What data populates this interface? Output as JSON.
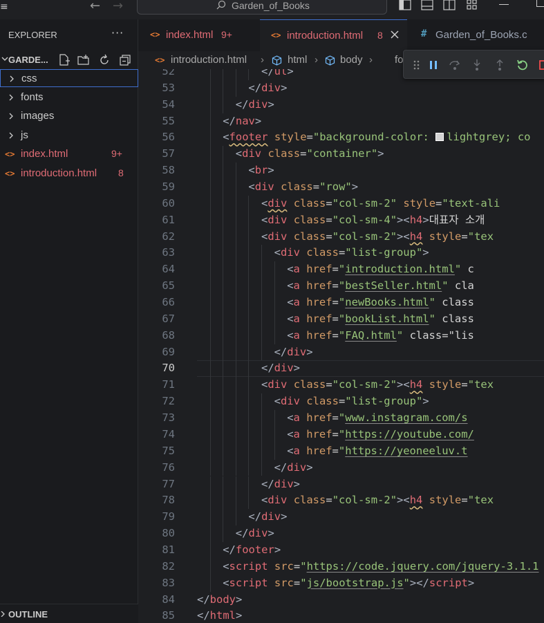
{
  "titlebar": {
    "search_text": "Garden_of_Books",
    "back_arrow": "←",
    "forward_arrow": "→"
  },
  "sidebar": {
    "header": "EXPLORER",
    "more": "···",
    "folder": "GARDE...",
    "items": [
      {
        "label": "css",
        "type": "folder"
      },
      {
        "label": "fonts",
        "type": "folder"
      },
      {
        "label": "images",
        "type": "folder"
      },
      {
        "label": "js",
        "type": "folder"
      },
      {
        "label": "index.html",
        "type": "file",
        "count": "9+"
      },
      {
        "label": "introduction.html",
        "type": "file",
        "count": "8"
      }
    ],
    "outline": "OUTLINE"
  },
  "tabs": [
    {
      "icon": "<>",
      "label": "index.html",
      "badge": "9+"
    },
    {
      "icon": "<>",
      "label": "introduction.html",
      "badge": "8"
    },
    {
      "icon": "#",
      "label": "Garden_of_Books.c"
    }
  ],
  "breadcrumb": [
    "introduction.html",
    "html",
    "body",
    "fo"
  ],
  "colors": {
    "accent": "#3f6fcf",
    "error": "#e06c75",
    "debug_continue": "#3794ff",
    "debug_restart": "#89d185",
    "debug_stop": "#f14c4c"
  },
  "editor": {
    "current_line": "70",
    "lines": [
      {
        "n": "52",
        "indent": 10,
        "tokens": [
          [
            "br",
            "</"
          ],
          [
            "tag",
            "ul"
          ],
          [
            "br",
            ">"
          ]
        ]
      },
      {
        "n": "53",
        "indent": 8,
        "tokens": [
          [
            "br",
            "</"
          ],
          [
            "tag",
            "div"
          ],
          [
            "br",
            ">"
          ]
        ]
      },
      {
        "n": "54",
        "indent": 6,
        "tokens": [
          [
            "br",
            "</"
          ],
          [
            "tag",
            "div"
          ],
          [
            "br",
            ">"
          ]
        ]
      },
      {
        "n": "55",
        "indent": 4,
        "tokens": [
          [
            "br",
            "</"
          ],
          [
            "tag",
            "nav"
          ],
          [
            "br",
            ">"
          ]
        ]
      },
      {
        "n": "56",
        "indent": 4,
        "tokens": [
          [
            "br",
            "<"
          ],
          [
            "tagsq",
            "footer"
          ],
          [
            "txt",
            " "
          ],
          [
            "attr",
            "style"
          ],
          [
            "txt",
            "="
          ],
          [
            "str",
            "\"background-color: "
          ],
          [
            "swatch",
            ""
          ],
          [
            "str",
            "lightgrey; co"
          ]
        ]
      },
      {
        "n": "57",
        "indent": 6,
        "tokens": [
          [
            "br",
            "<"
          ],
          [
            "tag",
            "div"
          ],
          [
            "txt",
            " "
          ],
          [
            "attr",
            "class"
          ],
          [
            "txt",
            "="
          ],
          [
            "str",
            "\"container\""
          ],
          [
            "br",
            ">"
          ]
        ]
      },
      {
        "n": "58",
        "indent": 8,
        "tokens": [
          [
            "br",
            "<"
          ],
          [
            "tag",
            "br"
          ],
          [
            "br",
            ">"
          ]
        ]
      },
      {
        "n": "59",
        "indent": 8,
        "tokens": [
          [
            "br",
            "<"
          ],
          [
            "tag",
            "div"
          ],
          [
            "txt",
            " "
          ],
          [
            "attr",
            "class"
          ],
          [
            "txt",
            "="
          ],
          [
            "str",
            "\"row\""
          ],
          [
            "br",
            ">"
          ]
        ]
      },
      {
        "n": "60",
        "indent": 10,
        "tokens": [
          [
            "br",
            "<"
          ],
          [
            "tagsq",
            "div"
          ],
          [
            "txt",
            " "
          ],
          [
            "attr",
            "class"
          ],
          [
            "txt",
            "="
          ],
          [
            "str",
            "\"col-sm-2\""
          ],
          [
            "txt",
            " "
          ],
          [
            "attr",
            "style"
          ],
          [
            "txt",
            "="
          ],
          [
            "str",
            "\"text-ali"
          ]
        ]
      },
      {
        "n": "61",
        "indent": 10,
        "tokens": [
          [
            "br",
            "<"
          ],
          [
            "tag",
            "div"
          ],
          [
            "txt",
            " "
          ],
          [
            "attr",
            "class"
          ],
          [
            "txt",
            "="
          ],
          [
            "str",
            "\"col-sm-4\""
          ],
          [
            "br",
            ">"
          ],
          [
            "br",
            "<"
          ],
          [
            "tag",
            "h4"
          ],
          [
            "br",
            ">"
          ],
          [
            "txt",
            "대표자 소개"
          ]
        ]
      },
      {
        "n": "62",
        "indent": 10,
        "tokens": [
          [
            "br",
            "<"
          ],
          [
            "tag",
            "div"
          ],
          [
            "txt",
            " "
          ],
          [
            "attr",
            "class"
          ],
          [
            "txt",
            "="
          ],
          [
            "str",
            "\"col-sm-2\""
          ],
          [
            "br",
            ">"
          ],
          [
            "br",
            "<"
          ],
          [
            "tagsq",
            "h4"
          ],
          [
            "txt",
            " "
          ],
          [
            "attr",
            "style"
          ],
          [
            "txt",
            "="
          ],
          [
            "str",
            "\"tex"
          ]
        ]
      },
      {
        "n": "63",
        "indent": 12,
        "tokens": [
          [
            "br",
            "<"
          ],
          [
            "tag",
            "div"
          ],
          [
            "txt",
            " "
          ],
          [
            "attr",
            "class"
          ],
          [
            "txt",
            "="
          ],
          [
            "str",
            "\"list-group\""
          ],
          [
            "br",
            ">"
          ]
        ]
      },
      {
        "n": "64",
        "indent": 14,
        "tokens": [
          [
            "br",
            "<"
          ],
          [
            "tag",
            "a"
          ],
          [
            "txt",
            " "
          ],
          [
            "attr",
            "href"
          ],
          [
            "txt",
            "="
          ],
          [
            "str",
            "\""
          ],
          [
            "strul",
            "introduction.html"
          ],
          [
            "str",
            "\""
          ],
          [
            "txt",
            " c"
          ]
        ]
      },
      {
        "n": "65",
        "indent": 14,
        "tokens": [
          [
            "br",
            "<"
          ],
          [
            "tag",
            "a"
          ],
          [
            "txt",
            " "
          ],
          [
            "attr",
            "href"
          ],
          [
            "txt",
            "="
          ],
          [
            "str",
            "\""
          ],
          [
            "strul",
            "bestSeller.html"
          ],
          [
            "str",
            "\""
          ],
          [
            "txt",
            " cla"
          ]
        ]
      },
      {
        "n": "66",
        "indent": 14,
        "tokens": [
          [
            "br",
            "<"
          ],
          [
            "tag",
            "a"
          ],
          [
            "txt",
            " "
          ],
          [
            "attr",
            "href"
          ],
          [
            "txt",
            "="
          ],
          [
            "str",
            "\""
          ],
          [
            "strul",
            "newBooks.html"
          ],
          [
            "str",
            "\""
          ],
          [
            "txt",
            " class"
          ]
        ]
      },
      {
        "n": "67",
        "indent": 14,
        "tokens": [
          [
            "br",
            "<"
          ],
          [
            "tag",
            "a"
          ],
          [
            "txt",
            " "
          ],
          [
            "attr",
            "href"
          ],
          [
            "txt",
            "="
          ],
          [
            "str",
            "\""
          ],
          [
            "strul",
            "bookList.html"
          ],
          [
            "str",
            "\""
          ],
          [
            "txt",
            " class"
          ]
        ]
      },
      {
        "n": "68",
        "indent": 14,
        "tokens": [
          [
            "br",
            "<"
          ],
          [
            "tag",
            "a"
          ],
          [
            "txt",
            " "
          ],
          [
            "attr",
            "href"
          ],
          [
            "txt",
            "="
          ],
          [
            "str",
            "\""
          ],
          [
            "strul",
            "FAQ.html"
          ],
          [
            "str",
            "\""
          ],
          [
            "txt",
            " class"
          ],
          [
            "txt",
            "=\"lis"
          ]
        ]
      },
      {
        "n": "69",
        "indent": 12,
        "tokens": [
          [
            "br",
            "</"
          ],
          [
            "tag",
            "div"
          ],
          [
            "br",
            ">"
          ]
        ]
      },
      {
        "n": "70",
        "indent": 10,
        "tokens": [
          [
            "br",
            "</"
          ],
          [
            "tag",
            "div"
          ],
          [
            "br",
            ">"
          ]
        ]
      },
      {
        "n": "71",
        "indent": 10,
        "tokens": [
          [
            "br",
            "<"
          ],
          [
            "tag",
            "div"
          ],
          [
            "txt",
            " "
          ],
          [
            "attr",
            "class"
          ],
          [
            "txt",
            "="
          ],
          [
            "str",
            "\"col-sm-2\""
          ],
          [
            "br",
            ">"
          ],
          [
            "br",
            "<"
          ],
          [
            "tagsq",
            "h4"
          ],
          [
            "txt",
            " "
          ],
          [
            "attr",
            "style"
          ],
          [
            "txt",
            "="
          ],
          [
            "str",
            "\"tex"
          ]
        ]
      },
      {
        "n": "72",
        "indent": 12,
        "tokens": [
          [
            "br",
            "<"
          ],
          [
            "tag",
            "div"
          ],
          [
            "txt",
            " "
          ],
          [
            "attr",
            "class"
          ],
          [
            "txt",
            "="
          ],
          [
            "str",
            "\"list-group\""
          ],
          [
            "br",
            ">"
          ]
        ]
      },
      {
        "n": "73",
        "indent": 14,
        "tokens": [
          [
            "br",
            "<"
          ],
          [
            "tag",
            "a"
          ],
          [
            "txt",
            " "
          ],
          [
            "attr",
            "href"
          ],
          [
            "txt",
            "="
          ],
          [
            "str",
            "\""
          ],
          [
            "strul",
            "www.instagram.com/s"
          ]
        ]
      },
      {
        "n": "74",
        "indent": 14,
        "tokens": [
          [
            "br",
            "<"
          ],
          [
            "tag",
            "a"
          ],
          [
            "txt",
            " "
          ],
          [
            "attr",
            "href"
          ],
          [
            "txt",
            "="
          ],
          [
            "str",
            "\""
          ],
          [
            "strul",
            "https://youtube.com/"
          ]
        ]
      },
      {
        "n": "75",
        "indent": 14,
        "tokens": [
          [
            "br",
            "<"
          ],
          [
            "tag",
            "a"
          ],
          [
            "txt",
            " "
          ],
          [
            "attr",
            "href"
          ],
          [
            "txt",
            "="
          ],
          [
            "str",
            "\""
          ],
          [
            "strul",
            "https://yeoneeluv.t"
          ]
        ]
      },
      {
        "n": "76",
        "indent": 12,
        "tokens": [
          [
            "br",
            "</"
          ],
          [
            "tag",
            "div"
          ],
          [
            "br",
            ">"
          ]
        ]
      },
      {
        "n": "77",
        "indent": 10,
        "tokens": [
          [
            "br",
            "</"
          ],
          [
            "tag",
            "div"
          ],
          [
            "br",
            ">"
          ]
        ]
      },
      {
        "n": "78",
        "indent": 10,
        "tokens": [
          [
            "br",
            "<"
          ],
          [
            "tag",
            "div"
          ],
          [
            "txt",
            " "
          ],
          [
            "attr",
            "class"
          ],
          [
            "txt",
            "="
          ],
          [
            "str",
            "\"col-sm-2\""
          ],
          [
            "br",
            ">"
          ],
          [
            "br",
            "<"
          ],
          [
            "tagsq",
            "h4"
          ],
          [
            "txt",
            " "
          ],
          [
            "attr",
            "style"
          ],
          [
            "txt",
            "="
          ],
          [
            "str",
            "\"tex"
          ]
        ]
      },
      {
        "n": "79",
        "indent": 8,
        "tokens": [
          [
            "br",
            "</"
          ],
          [
            "tag",
            "div"
          ],
          [
            "br",
            ">"
          ]
        ]
      },
      {
        "n": "80",
        "indent": 6,
        "tokens": [
          [
            "br",
            "</"
          ],
          [
            "tag",
            "div"
          ],
          [
            "br",
            ">"
          ]
        ]
      },
      {
        "n": "81",
        "indent": 4,
        "tokens": [
          [
            "br",
            "</"
          ],
          [
            "tag",
            "footer"
          ],
          [
            "br",
            ">"
          ]
        ]
      },
      {
        "n": "82",
        "indent": 4,
        "tokens": [
          [
            "br",
            "<"
          ],
          [
            "tag",
            "script"
          ],
          [
            "txt",
            " "
          ],
          [
            "attr",
            "src"
          ],
          [
            "txt",
            "="
          ],
          [
            "str",
            "\""
          ],
          [
            "strul",
            "https://code.jquery.com/jquery-3.1.1"
          ]
        ]
      },
      {
        "n": "83",
        "indent": 4,
        "tokens": [
          [
            "br",
            "<"
          ],
          [
            "tag",
            "script"
          ],
          [
            "txt",
            " "
          ],
          [
            "attr",
            "src"
          ],
          [
            "txt",
            "="
          ],
          [
            "str",
            "\""
          ],
          [
            "strul",
            "js/bootstrap.js"
          ],
          [
            "str",
            "\""
          ],
          [
            "br",
            "></"
          ],
          [
            "tag",
            "script"
          ],
          [
            "br",
            ">"
          ]
        ]
      },
      {
        "n": "84",
        "indent": 0,
        "tokens": [
          [
            "br",
            "</"
          ],
          [
            "tag",
            "body"
          ],
          [
            "br",
            ">"
          ]
        ]
      },
      {
        "n": "85",
        "indent": 0,
        "tokens": [
          [
            "br",
            "</"
          ],
          [
            "tag",
            "html"
          ],
          [
            "br",
            ">"
          ]
        ]
      }
    ]
  }
}
